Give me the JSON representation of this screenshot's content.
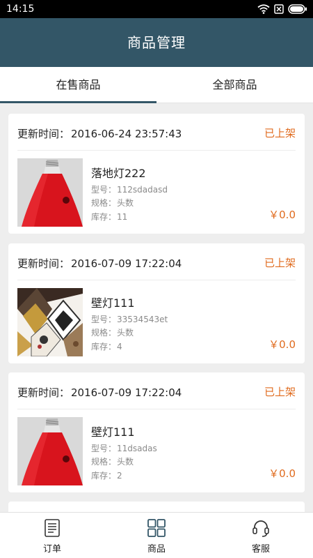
{
  "status_bar": {
    "time": "14:15",
    "icons": [
      "wifi-icon",
      "sim-off-icon",
      "battery-icon"
    ]
  },
  "header": {
    "title": "商品管理"
  },
  "tabs": [
    {
      "label": "在售商品",
      "active": true
    },
    {
      "label": "全部商品",
      "active": false
    }
  ],
  "products": [
    {
      "update_label": "更新时间：",
      "update_time": "2016-06-24 23:57:43",
      "status": "已上架",
      "name": "落地灯222",
      "model_label": "型号：",
      "model": "112sdadasd",
      "spec_label": "规格：",
      "spec": "头数",
      "stock_label": "库存：",
      "stock": "11",
      "price": "￥0.0",
      "image": "red-lamp"
    },
    {
      "update_label": "更新时间：",
      "update_time": "2016-07-09 17:22:04",
      "status": "已上架",
      "name": "壁灯111",
      "model_label": "型号：",
      "model": "33534543et",
      "spec_label": "规格：",
      "spec": "头数",
      "stock_label": "库存：",
      "stock": "4",
      "price": "￥0.0",
      "image": "chandelier-collage"
    },
    {
      "update_label": "更新时间：",
      "update_time": "2016-07-09 17:22:04",
      "status": "已上架",
      "name": "壁灯111",
      "model_label": "型号：",
      "model": "11dsadas",
      "spec_label": "规格：",
      "spec": "头数",
      "stock_label": "库存：",
      "stock": "2",
      "price": "￥0.0",
      "image": "red-lamp"
    }
  ],
  "bottom_nav": [
    {
      "label": "订单",
      "icon": "order-list-icon"
    },
    {
      "label": "商品",
      "icon": "grid-icon"
    },
    {
      "label": "客服",
      "icon": "headset-icon"
    }
  ],
  "colors": {
    "header": "#335667",
    "accent": "#e06b1e",
    "background": "#eeeeee"
  }
}
